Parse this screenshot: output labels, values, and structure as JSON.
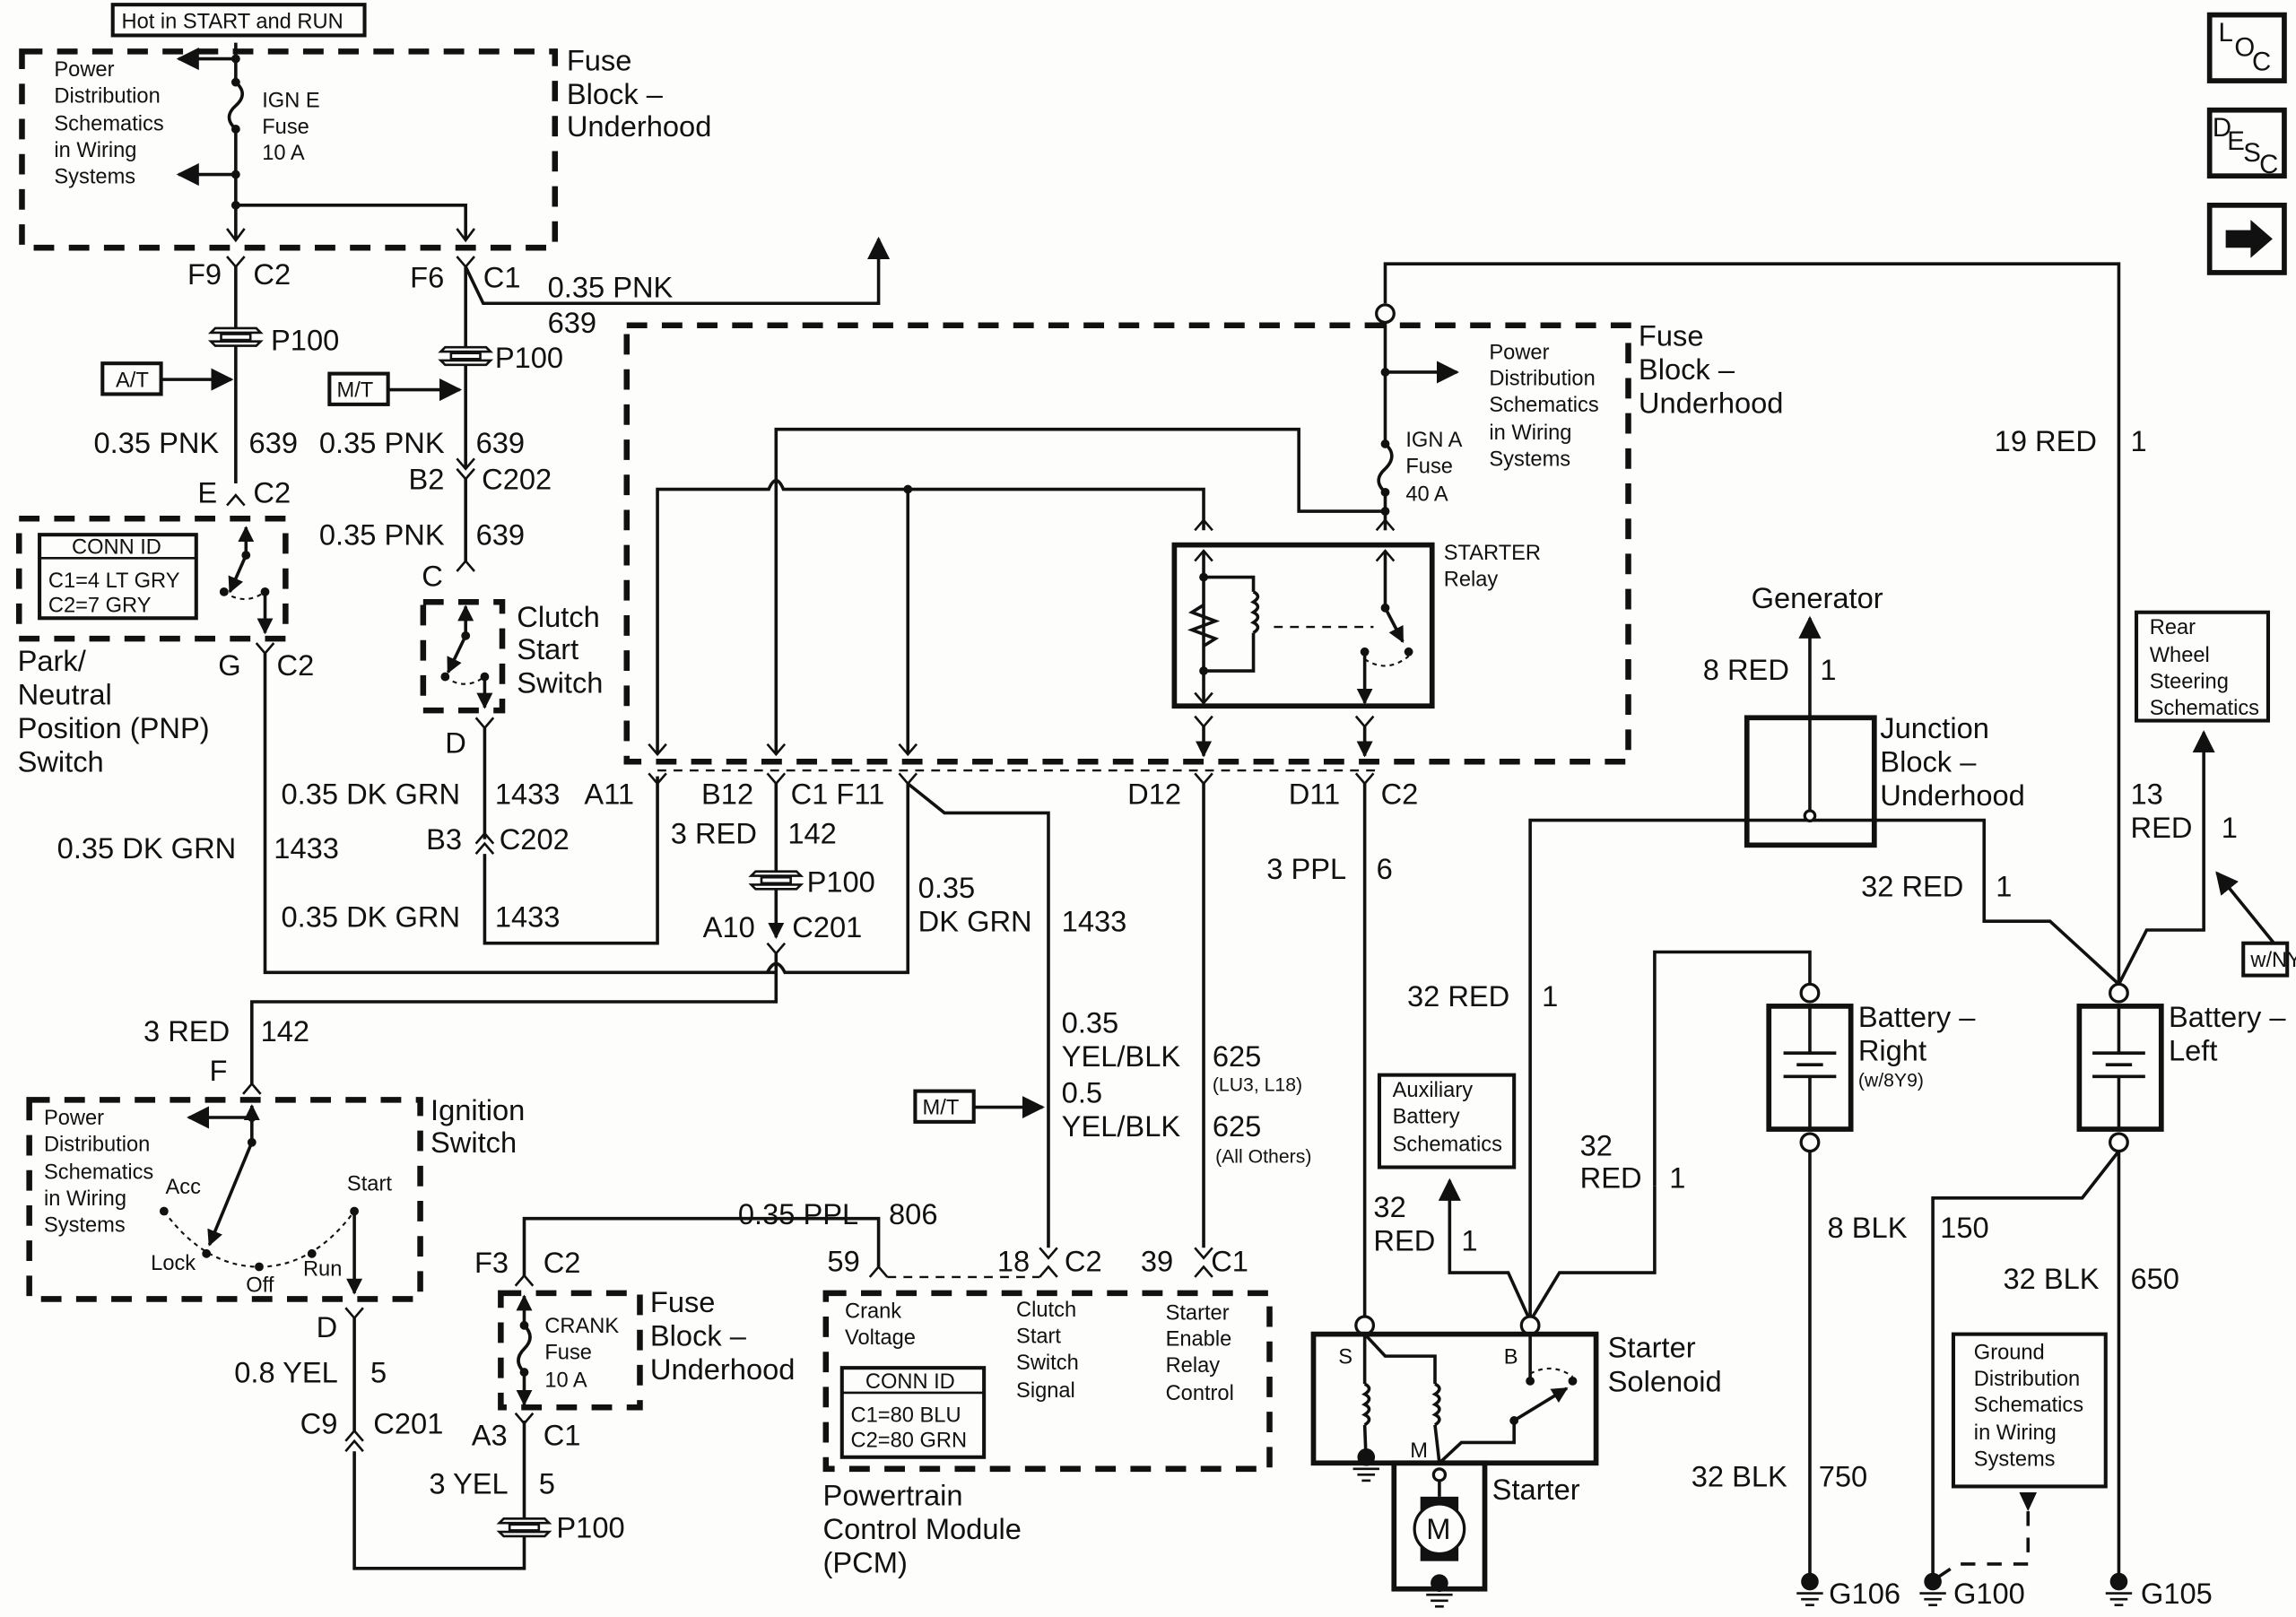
{
  "diagram": {
    "title_box": "Hot in START and RUN",
    "nav_buttons": [
      {
        "name": "loc",
        "letters": [
          "L",
          "O",
          "C"
        ]
      },
      {
        "name": "desc",
        "letters": [
          "D",
          "E",
          "S",
          "C"
        ]
      },
      {
        "name": "next",
        "icon": "right-arrow-icon"
      }
    ],
    "components": {
      "fuse_block_top": [
        "Fuse",
        "Block –",
        "Underhood"
      ],
      "fuse_block_mid": [
        "Fuse",
        "Block –",
        "Underhood"
      ],
      "fuse_block_bottom": [
        "Fuse",
        "Block –",
        "Underhood"
      ],
      "ign_e_fuse": [
        "IGN E",
        "Fuse",
        "10 A"
      ],
      "ign_a_fuse": [
        "IGN A",
        "Fuse",
        "40 A"
      ],
      "crank_fuse": [
        "CRANK",
        "Fuse",
        "10 A"
      ],
      "power_dist_top": [
        "Power",
        "Distribution",
        "Schematics",
        "in Wiring",
        "Systems"
      ],
      "power_dist_box": [
        "Power Distribution",
        "Schematics in",
        "Wiring Systems"
      ],
      "power_dist_relay": [
        "Power",
        "Distribution",
        "Schematics",
        "in Wiring",
        "Systems"
      ],
      "power_dist_ign": [
        "Power",
        "Distribution",
        "Schematics",
        "in Wiring",
        "Systems"
      ],
      "starter_relay": [
        "STARTER",
        "Relay"
      ],
      "pnp_switch": [
        "Park/",
        "Neutral",
        "Position (PNP)",
        "Switch"
      ],
      "pnp_conn_id": {
        "title": "CONN ID",
        "lines": [
          "C1=4 LT GRY",
          "C2=7 GRY"
        ]
      },
      "clutch_switch": [
        "Clutch",
        "Start",
        "Switch"
      ],
      "ignition_switch": [
        "Ignition",
        "Switch"
      ],
      "ignition_positions": [
        "Acc",
        "Lock",
        "Off",
        "Run",
        "Start"
      ],
      "pcm": [
        "Powertrain",
        "Control Module",
        "(PCM)"
      ],
      "pcm_conn_id": {
        "title": "CONN ID",
        "lines": [
          "C1=80 BLU",
          "C2=80 GRN"
        ]
      },
      "pcm_inputs": [
        [
          "Crank",
          "Voltage"
        ],
        [
          "Clutch",
          "Start",
          "Switch",
          "Signal"
        ],
        [
          "Starter",
          "Enable",
          "Relay",
          "Control"
        ]
      ],
      "generator": "Generator",
      "junction_block": [
        "Junction",
        "Block –",
        "Underhood"
      ],
      "rear_wheel_box": [
        "Rear",
        "Wheel",
        "Steering",
        "Schematics"
      ],
      "wnys": "w/NYS",
      "aux_battery_box": [
        "Auxiliary",
        "Battery",
        "Schematics"
      ],
      "battery_right": [
        "Battery –",
        "Right",
        "(w/8Y9)"
      ],
      "battery_left": [
        "Battery –",
        "Left"
      ],
      "starter_solenoid": [
        "Starter",
        "Solenoid"
      ],
      "starter": "Starter",
      "solenoid_terminals": [
        "S",
        "B",
        "M"
      ],
      "motor": "M",
      "ground_dist_box": [
        "Ground",
        "Distribution",
        "Schematics",
        "in Wiring",
        "Systems"
      ],
      "grounds": [
        "G106",
        "G100",
        "G105"
      ],
      "option_tags": {
        "at": "A/T",
        "mt1": "M/T",
        "mt2": "M/T",
        "mt3": "M/T"
      }
    },
    "connectors": {
      "f9": "F9",
      "c2_a": "C2",
      "f6": "F6",
      "c1_a": "C1",
      "p100_a": "P100",
      "p100_b": "P100",
      "p100_c": "P100",
      "p100_d": "P100",
      "e": "E",
      "c2_b": "C2",
      "b2": "B2",
      "c202_a": "C202",
      "c": "C",
      "g": "G",
      "c2_c": "C2",
      "d": "D",
      "a11": "A11",
      "b12": "B12",
      "c1f11": "C1 F11",
      "d12": "D12",
      "d11": "D11",
      "c2_d": "C2",
      "b3": "B3",
      "c202_b": "C202",
      "a10": "A10",
      "c201_a": "C201",
      "f": "F",
      "d_ign": "D",
      "c9": "C9",
      "c201_b": "C201",
      "f3": "F3",
      "c2_e": "C2",
      "a3": "A3",
      "c1_b": "C1",
      "pcm59": "59",
      "pcm18": "18",
      "pcm_c2": "C2",
      "pcm39": "39",
      "pcm_c1": "C1"
    },
    "wires": {
      "w1": {
        "gauge": "0.35 PNK",
        "circuit": "639"
      },
      "w2": {
        "gauge": "0.35 PNK",
        "circuit": "639"
      },
      "w3": {
        "gauge": "0.35 PNK",
        "circuit": "639"
      },
      "w4": {
        "gauge": "0.35 PNK",
        "circuit": "639"
      },
      "w5": {
        "gauge": "0.35 DK GRN",
        "circuit": "1433"
      },
      "w6": {
        "gauge": "0.35 DK GRN",
        "circuit": "1433"
      },
      "w7": {
        "gauge": "0.35 DK GRN",
        "circuit": "1433"
      },
      "w8": {
        "gauge": "3 RED",
        "circuit": "142"
      },
      "w9": {
        "gauge": [
          "0.35",
          "DK GRN"
        ],
        "circuit": "1433"
      },
      "w10": {
        "gauge": "3 RED",
        "circuit": "142"
      },
      "w11": {
        "gauge": "0.8 YEL",
        "circuit": "5"
      },
      "w12": {
        "gauge": "3 YEL",
        "circuit": "5"
      },
      "w13": {
        "gauge": "0.35 PPL",
        "circuit": "806"
      },
      "w14": {
        "gauge": [
          "0.35",
          "YEL/BLK",
          "0.5",
          "YEL/BLK"
        ],
        "circuit": [
          "625",
          "(LU3, L18)",
          "625",
          "(All Others)"
        ]
      },
      "w15": {
        "gauge": "3 PPL",
        "circuit": "6"
      },
      "w16": {
        "gauge": "19 RED",
        "circuit": "1"
      },
      "w17": {
        "gauge": "8 RED",
        "circuit": "1"
      },
      "w18": {
        "gauge": "32 RED",
        "circuit": "1"
      },
      "w19": {
        "gauge": [
          "13",
          "RED"
        ],
        "circuit": "1"
      },
      "w20": {
        "gauge": "32 RED",
        "circuit": "1"
      },
      "w21": {
        "gauge": [
          "32",
          "RED"
        ],
        "circuit": "1"
      },
      "w22": {
        "gauge": [
          "32",
          "RED"
        ],
        "circuit": "1"
      },
      "w23": {
        "gauge": "8 BLK",
        "circuit": "150"
      },
      "w24": {
        "gauge": "32 BLK",
        "circuit": "650"
      },
      "w25": {
        "gauge": "32 BLK",
        "circuit": "750"
      }
    }
  }
}
